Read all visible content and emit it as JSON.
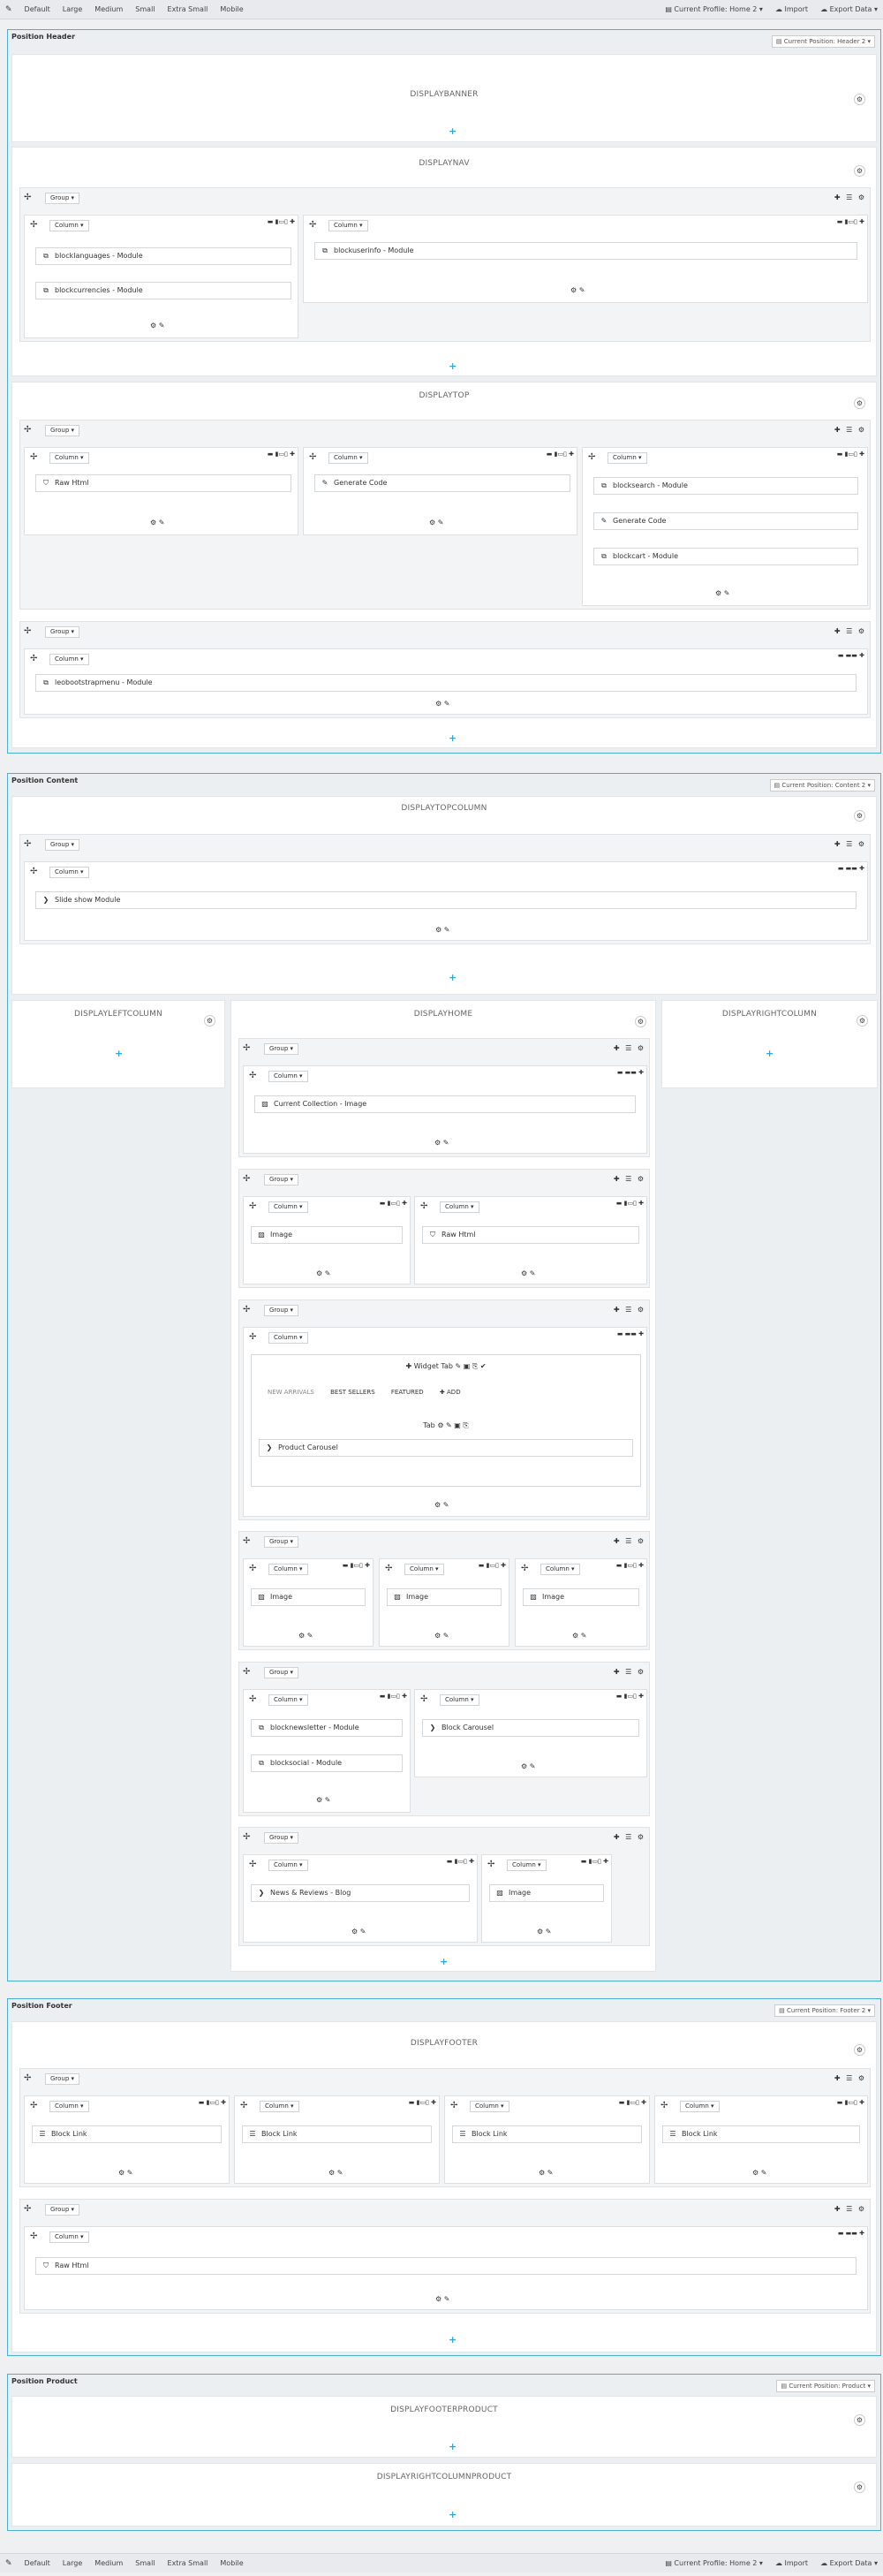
{
  "toolbar": {
    "devices": [
      "Default",
      "Large",
      "Medium",
      "Small",
      "Extra Small",
      "Mobile"
    ],
    "profile": "Current Profile: Home 2 ▾",
    "import": "Import",
    "export": "Export Data ▾"
  },
  "ui": {
    "group": "Group ▾",
    "column": "Column ▾",
    "gear": "⚙",
    "add": "+",
    "group_tools": "✚ ☰ ⚙",
    "col_tools": "▬ ▮▭▯ ✚",
    "col_tools_wide": "▬ ▬▬ ✚",
    "footer_tools": "⚙ ✎"
  },
  "header": {
    "title": "Position Header",
    "position_btn": "Current Position: Header 2 ▾",
    "hooks": {
      "banner": "DISPLAYBANNER",
      "nav": "DISPLAYNAV",
      "top": "DISPLAYTOP"
    },
    "widgets": {
      "blocklanguages": "blocklanguages - Module",
      "blockcurrencies": "blockcurrencies - Module",
      "blockuserinfo": "blockuserinfo - Module",
      "raw_html": "Raw Html",
      "generate_code": "Generate Code",
      "blocksearch": "blocksearch - Module",
      "generate_code2": "Generate Code",
      "blockcart": "blockcart - Module",
      "leobootstrapmenu": "leobootstrapmenu - Module"
    }
  },
  "content": {
    "title": "Position Content",
    "position_btn": "Current Position: Content 2 ▾",
    "hooks": {
      "topcolumn": "DISPLAYTOPCOLUMN",
      "leftcolumn": "DISPLAYLEFTCOLUMN",
      "home": "DISPLAYHOME",
      "rightcolumn": "DISPLAYRIGHTCOLUMN"
    },
    "widgets": {
      "slideshow": "Slide show Module",
      "current_collection": "Current Collection - Image",
      "image1": "Image",
      "raw_html": "Raw Html",
      "product_carousel": "Product Carousel",
      "img_a": "Image",
      "img_b": "Image",
      "img_c": "Image",
      "blocknewsletter": "blocknewsletter - Module",
      "blocksocial": "blocksocial - Module",
      "block_carousel": "Block Carousel",
      "news_reviews": "News & Reviews - Blog",
      "img_d": "Image"
    },
    "widget_tab": {
      "label": "✚ Widget Tab",
      "tools": "✎ ▣ ⎘ ✔",
      "tabs": [
        "NEW ARRIVALS",
        "BEST SELLERS",
        "FEATURED",
        "✚ ADD"
      ],
      "tab_label": "Tab",
      "tab_tools": "⚙ ✎ ▣ ⎘"
    }
  },
  "footer": {
    "title": "Position Footer",
    "position_btn": "Current Position: Footer 2 ▾",
    "hooks": {
      "footer": "DISPLAYFOOTER"
    },
    "widgets": {
      "link1": "Block Link",
      "link2": "Block Link",
      "link3": "Block Link",
      "link4": "Block Link",
      "raw_html": "Raw Html"
    }
  },
  "product": {
    "title": "Position Product",
    "position_btn": "Current Position: Product ▾",
    "hooks": {
      "footerproduct": "DISPLAYFOOTERPRODUCT",
      "rightcolumnproduct": "DISPLAYRIGHTCOLUMNPRODUCT"
    }
  },
  "colors": {
    "accent": "#4dafd6",
    "add": "#2aa9e0"
  }
}
